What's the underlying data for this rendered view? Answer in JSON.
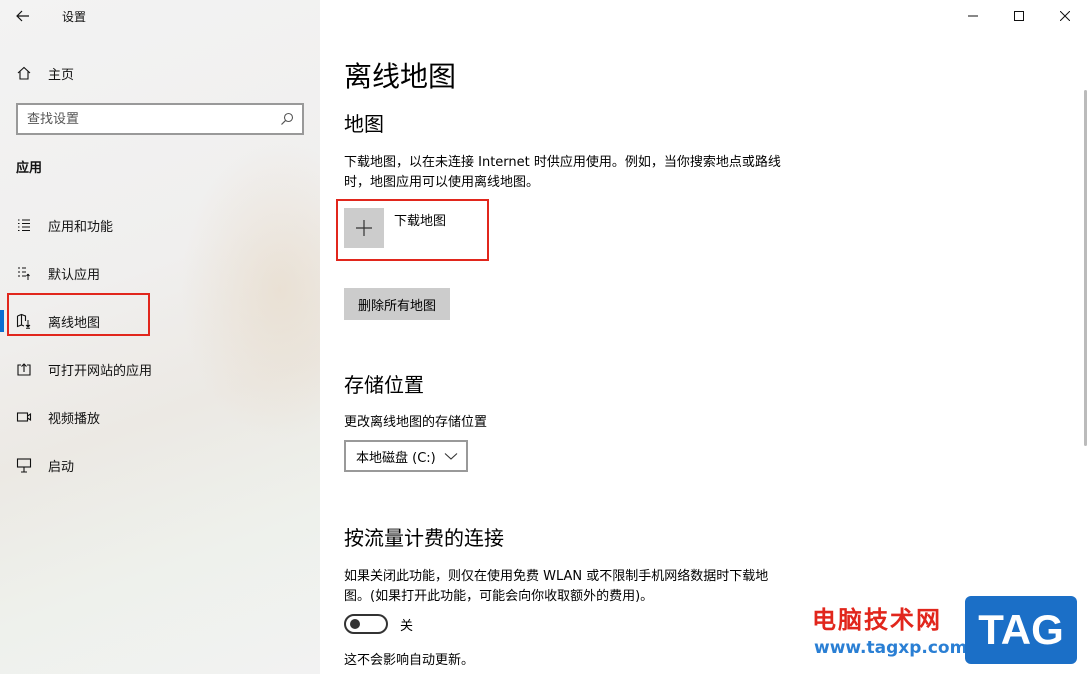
{
  "window": {
    "title": "设置"
  },
  "sidebar": {
    "home_label": "主页",
    "search_placeholder": "查找设置",
    "section_label": "应用",
    "items": [
      {
        "label": "应用和功能",
        "icon": "list-icon"
      },
      {
        "label": "默认应用",
        "icon": "default-apps-icon"
      },
      {
        "label": "离线地图",
        "icon": "map-icon",
        "active": true
      },
      {
        "label": "可打开网站的应用",
        "icon": "open-web-icon"
      },
      {
        "label": "视频播放",
        "icon": "video-icon"
      },
      {
        "label": "启动",
        "icon": "startup-icon"
      }
    ]
  },
  "main": {
    "page_title": "离线地图",
    "maps": {
      "heading": "地图",
      "description": "下载地图，以在未连接 Internet 时供应用使用。例如，当你搜索地点或路线时，地图应用可以使用离线地图。",
      "add_label": "下载地图",
      "delete_all_label": "删除所有地图"
    },
    "storage": {
      "heading": "存储位置",
      "description": "更改离线地图的存储位置",
      "selected": "本地磁盘 (C:)"
    },
    "metered": {
      "heading": "按流量计费的连接",
      "description": "如果关闭此功能，则仅在使用免费 WLAN 或不限制手机网络数据时下载地图。(如果打开此功能，可能会向你收取额外的费用)。",
      "toggle_label": "关",
      "toggle_on": false,
      "note": "这不会影响自动更新。"
    }
  },
  "watermark": {
    "cn_text": "电脑技术网",
    "url": "www.tagxp.com",
    "logo_text": "TAG"
  },
  "colors": {
    "accent": "#0a6ed1",
    "highlight": "#e1261c",
    "watermark_blue": "#1b6fc7"
  }
}
